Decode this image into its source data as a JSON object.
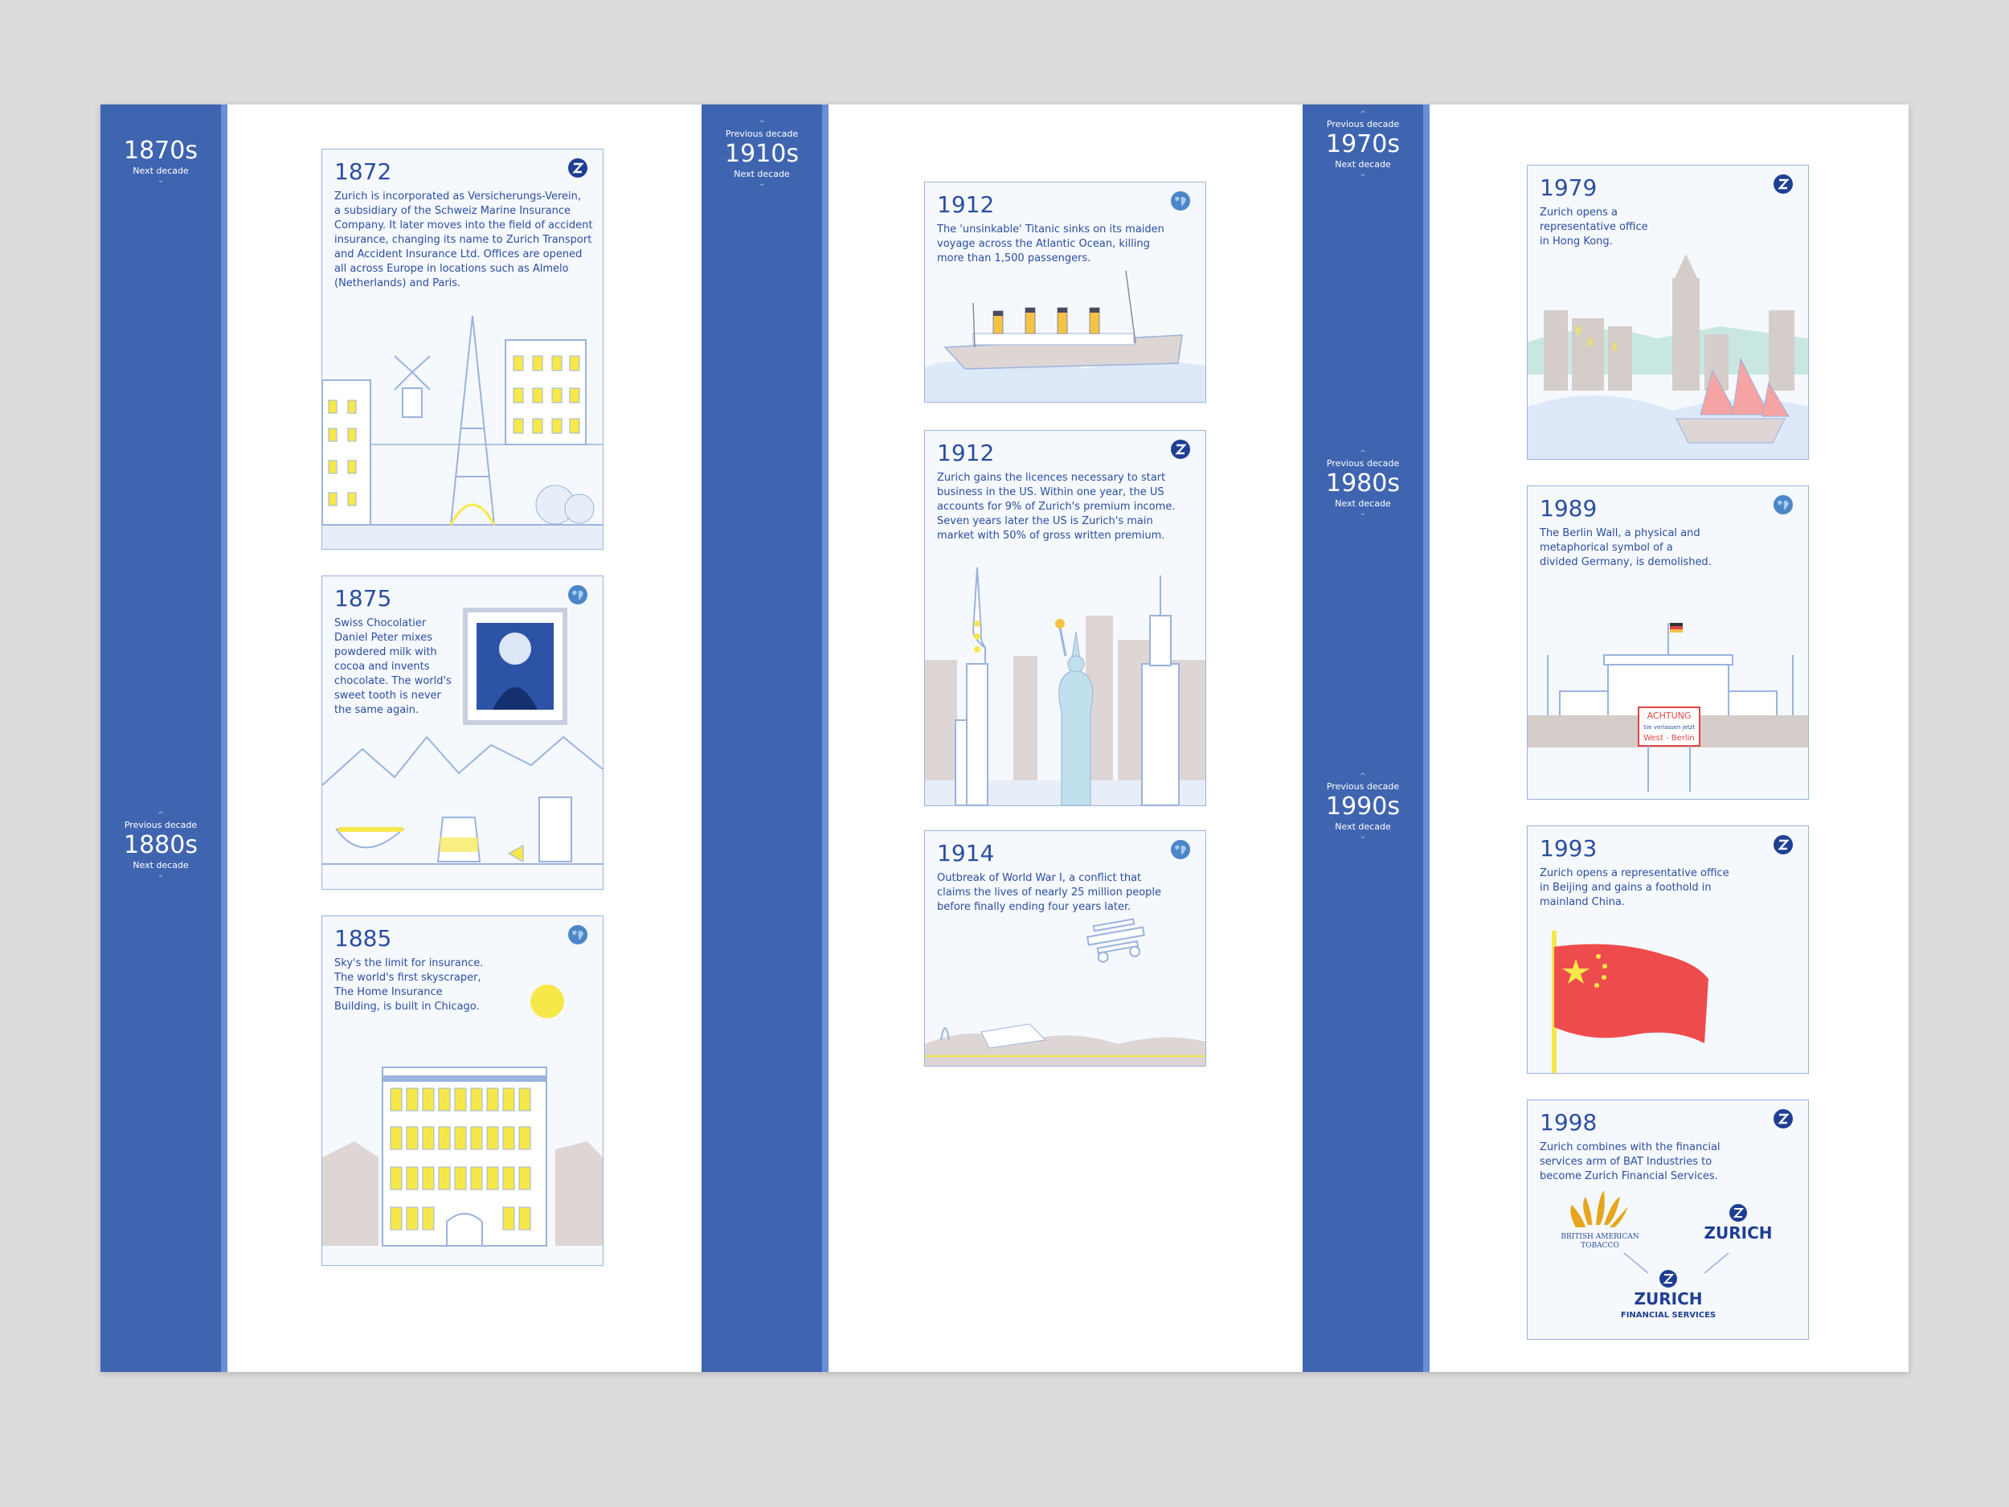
{
  "columns": [
    {
      "decades": [
        {
          "prev": "",
          "label": "1870s",
          "next": "Next decade"
        },
        {
          "prev": "Previous decade",
          "label": "1880s",
          "next": "Next decade"
        }
      ]
    },
    {
      "decades": [
        {
          "prev": "Previous decade",
          "label": "1910s",
          "next": "Next decade"
        }
      ]
    },
    {
      "decades": [
        {
          "prev": "Previous decade",
          "label": "1970s",
          "next": "Next decade"
        },
        {
          "prev": "Previous decade",
          "label": "1980s",
          "next": "Next decade"
        },
        {
          "prev": "Previous decade",
          "label": "1990s",
          "next": "Next decade"
        }
      ]
    }
  ],
  "cards": [
    {
      "year": "1872",
      "badge": "zurich-logo-icon",
      "text": "Zurich is incorporated as Versicherungs-Verein,\na subsidiary of the Schweiz Marine Insurance\nCompany. It later moves into the field of accident\ninsurance, changing its name to Zurich Transport\nand Accident Insurance Ltd. Offices are opened\nall across Europe in locations such as Almelo\n(Netherlands) and Paris."
    },
    {
      "year": "1875",
      "badge": "globe-icon",
      "text": "Swiss Chocolatier\nDaniel Peter mixes\npowdered milk with\ncocoa and invents\nchocolate. The world's\nsweet tooth is never\nthe same again."
    },
    {
      "year": "1885",
      "badge": "globe-icon",
      "text": "Sky's the limit for insurance.\nThe world's first skyscraper,\nThe Home Insurance\nBuilding, is built in Chicago."
    },
    {
      "year": "1912",
      "badge": "globe-icon",
      "text": "The 'unsinkable' Titanic sinks on its maiden\nvoyage across the Atlantic Ocean, killing\nmore than 1,500 passengers."
    },
    {
      "year": "1912",
      "badge": "zurich-logo-icon",
      "text": "Zurich gains the licences necessary to start\nbusiness in the US. Within one year, the US\naccounts for 9% of Zurich's premium income.\nSeven years later the US is Zurich's main\nmarket with 50% of gross written premium."
    },
    {
      "year": "1914",
      "badge": "globe-icon",
      "text": "Outbreak of World War I, a conflict that\nclaims the lives of nearly 25 million people\nbefore finally ending four years later."
    },
    {
      "year": "1979",
      "badge": "zurich-logo-icon",
      "text": "Zurich opens a\nrepresentative office\nin Hong Kong."
    },
    {
      "year": "1989",
      "badge": "globe-icon",
      "text": "The Berlin Wall, a physical and\nmetaphorical symbol of a\ndivided Germany, is demolished."
    },
    {
      "year": "1993",
      "badge": "zurich-logo-icon",
      "text": "Zurich opens a representative office\nin Beijing and gains a foothold in\nmainland China."
    },
    {
      "year": "1998",
      "badge": "zurich-logo-icon",
      "text": "Zurich combines with the financial\nservices arm of BAT Industries to\nbecome Zurich Financial Services."
    }
  ],
  "berlin_sign": {
    "title": "ACHTUNG",
    "line1": "Sie verlassen jetzt",
    "line2": "West - Berlin"
  },
  "logos": {
    "bat": "BRITISH AMERICAN\nTOBACCO",
    "zurich": "ZURICH",
    "zfs_name": "ZURICH",
    "zfs_sub": "FINANCIAL SERVICES"
  },
  "colors": {
    "sidebar": "#4065b0",
    "accent_yellow": "#f7e84a",
    "flag_red": "#ee4c4c",
    "line_blue": "#9bb3dd"
  }
}
